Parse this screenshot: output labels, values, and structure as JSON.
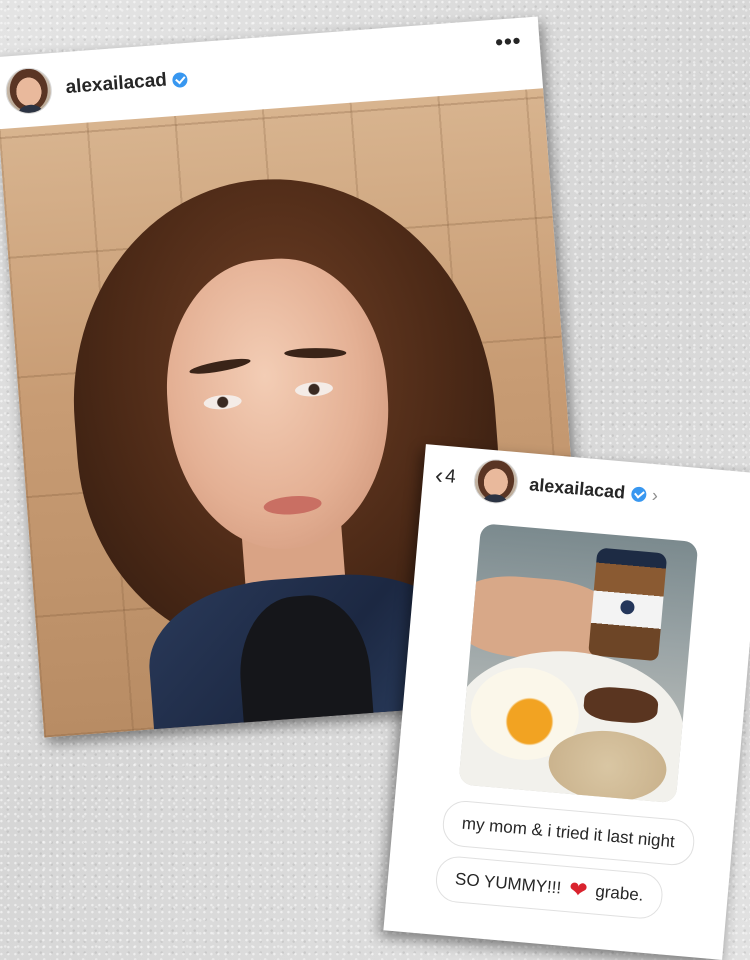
{
  "post": {
    "username": "alexailacad",
    "verified": true,
    "more_icon": "•••",
    "icons": [
      "avatar",
      "verified-badge-icon",
      "more-options-icon"
    ]
  },
  "dm": {
    "back_icon": "‹",
    "back_count": "4",
    "username": "alexailacad",
    "verified": true,
    "chevron_icon": "›",
    "messages": [
      {
        "text": "my mom & i tried it last night"
      },
      {
        "text_before": "SO YUMMY!!!",
        "emoji": "❤",
        "text_after": "grabe."
      }
    ]
  },
  "colors": {
    "verified_blue": "#3897f0",
    "heart_red": "#d9232e",
    "text_dark": "#262626"
  }
}
